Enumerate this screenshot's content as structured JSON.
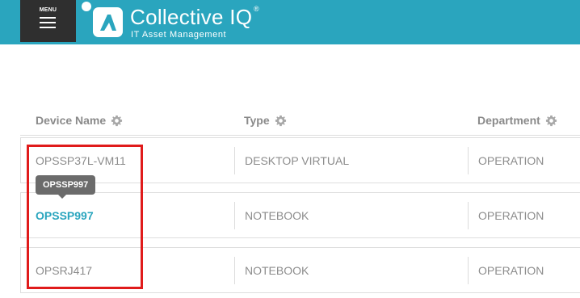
{
  "header": {
    "menu_label": "MENU",
    "brand_title": "Collective IQ",
    "brand_reg": "®",
    "brand_subtitle": "IT Asset Management",
    "bg_color": "#2aa5be"
  },
  "table": {
    "columns": [
      {
        "label": "Device Name",
        "icon": "gear-icon"
      },
      {
        "label": "Type",
        "icon": "gear-icon"
      },
      {
        "label": "Department",
        "icon": "gear-icon"
      }
    ],
    "rows": [
      {
        "device": "OPSSP37L-VM11",
        "type": "DESKTOP VIRTUAL",
        "department": "OPERATION"
      },
      {
        "device": "OPSSP997",
        "type": "NOTEBOOK",
        "department": "OPERATION"
      },
      {
        "device": "OPSRJ417",
        "type": "NOTEBOOK",
        "department": "OPERATION"
      }
    ]
  },
  "tooltip": {
    "text": "OPSSP997"
  },
  "colors": {
    "accent": "#2aa5be",
    "highlight": "#e01b1b",
    "dark": "#2f2f2f"
  }
}
